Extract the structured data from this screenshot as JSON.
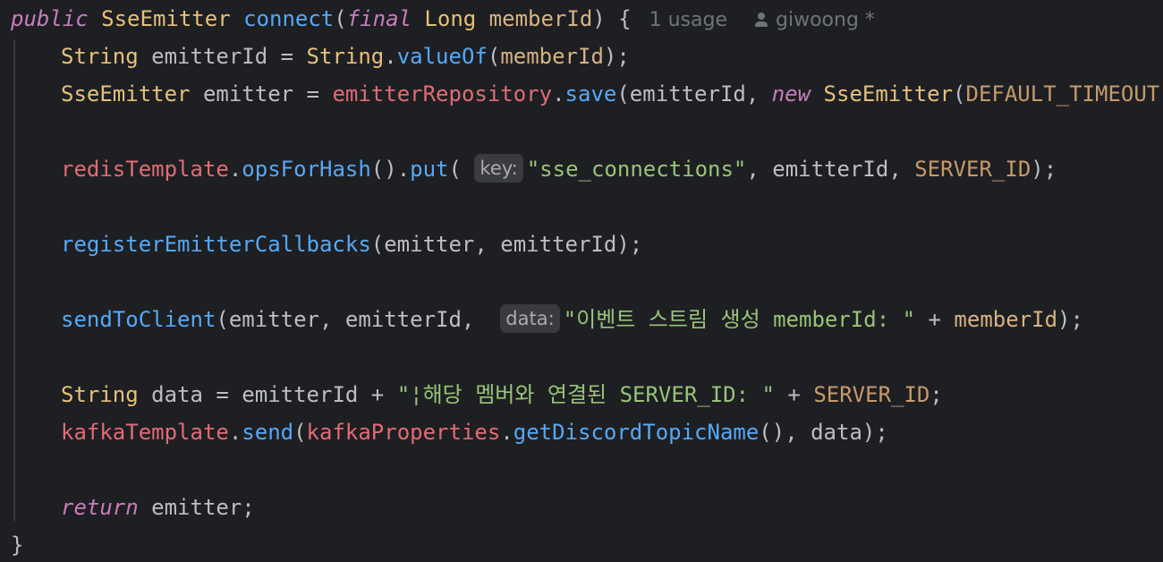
{
  "editor": {
    "signature": {
      "modifier": "public",
      "return_type": "SseEmitter",
      "method": "connect",
      "open_paren": "(",
      "param_modifier": "final",
      "param_type": "Long",
      "param_name": "memberId",
      "close": ") {",
      "usage": "1 usage",
      "author": "giwoong *"
    },
    "line2": {
      "type": "String",
      "var": " emitterId = ",
      "cls": "String",
      "dot": ".",
      "method": "valueOf",
      "open": "(",
      "arg": "memberId",
      "close": ");"
    },
    "line3": {
      "type": "SseEmitter",
      "var": " emitter = ",
      "field": "emitterRepository",
      "dot": ".",
      "method": "save",
      "args": "(emitterId, ",
      "kw_new": "new",
      "space": " ",
      "ctor": "SseEmitter",
      "open": "(",
      "const": "DEFAULT_TIMEOUT",
      "close": "));"
    },
    "line5": {
      "field": "redisTemplate",
      "dot1": ".",
      "m1": "opsForHash",
      "p1": "().",
      "m2": "put",
      "open": "( ",
      "hint": "key:",
      "str": "\"sse_connections\"",
      "mid": ", emitterId, ",
      "const": "SERVER_ID",
      "close": ");"
    },
    "line7": {
      "method": "registerEmitterCallbacks",
      "args": "(emitter, emitterId);"
    },
    "line9": {
      "method": "sendToClient",
      "args": "(emitter, emitterId,  ",
      "hint": "data:",
      "str": "\"이벤트 스트림 생성 memberId: \"",
      "plus": " + ",
      "param": "memberId",
      "close": ");"
    },
    "line11": {
      "type": "String",
      "mid": " data = emitterId + ",
      "str": "\"¦해당 멤버와 연결된 SERVER_ID: \"",
      "plus": " + ",
      "const": "SERVER_ID",
      "close": ";"
    },
    "line12": {
      "field1": "kafkaTemplate",
      "dot1": ".",
      "m1": "send",
      "open": "(",
      "field2": "kafkaProperties",
      "dot2": ".",
      "m2": "getDiscordTopicName",
      "close": "(), data);"
    },
    "line14": {
      "kw": "return",
      "rest": " emitter;"
    },
    "line15": {
      "brace": "}"
    }
  },
  "colors": {
    "background": "#1e1f22",
    "keyword": "#cf8e6d",
    "type": "#e5c07b",
    "method": "#56a8f5",
    "field": "#e06c75",
    "string": "#98c379"
  }
}
